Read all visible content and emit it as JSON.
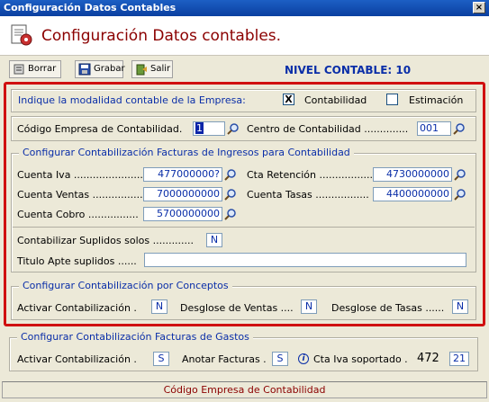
{
  "window": {
    "title": "Configuración Datos Contables",
    "close_glyph": "×"
  },
  "header": {
    "title": "Configuración Datos contables.",
    "icon": "document-settings-icon"
  },
  "toolbar": {
    "borrar_label": "Borrar",
    "grabar_label": "Grabar",
    "salir_label": "Salir",
    "nivel_label": "NIVEL CONTABLE: 10"
  },
  "modalidad": {
    "label": "Indique la modalidad contable de la Empresa:",
    "contabilidad_label": "Contabilidad",
    "contabilidad_checked": true,
    "contabilidad_mark": "X",
    "estimacion_label": "Estimación",
    "estimacion_checked": false
  },
  "empresa": {
    "codigo_label": "Código Empresa de Contabilidad.",
    "codigo_value": "1",
    "centro_label": "Centro de Contabilidad ..............",
    "centro_value": "001"
  },
  "ingresos": {
    "legend": "Configurar Contabilización Facturas de Ingresos para Contabilidad",
    "cuenta_iva_label": "Cuenta Iva .......................",
    "cuenta_iva_value": "477000000?",
    "cta_retencion_label": "Cta Retención .................",
    "cta_retencion_value": "4730000000",
    "cuenta_ventas_label": "Cuenta Ventas ................",
    "cuenta_ventas_value": "7000000000",
    "cuenta_tasas_label": "Cuenta Tasas .................",
    "cuenta_tasas_value": "4400000000",
    "cuenta_cobro_label": "Cuenta Cobro ................",
    "cuenta_cobro_value": "5700000000",
    "suplidos_label": "Contabilizar Suplidos solos .............",
    "suplidos_value": "N",
    "titulo_label": "Titulo Apte suplidos ......",
    "titulo_value": ""
  },
  "conceptos": {
    "legend": "Configurar Contabilización por Conceptos",
    "activar_label": "Activar Contabilización .",
    "activar_value": "N",
    "desglose_ventas_label": "Desglose de Ventas ....",
    "desglose_ventas_value": "N",
    "desglose_tasas_label": "Desglose de Tasas ......",
    "desglose_tasas_value": "N"
  },
  "gastos": {
    "legend": "Configurar Contabilización Facturas de Gastos",
    "activar_label": "Activar Contabilización .",
    "activar_value": "S",
    "anotar_label": "Anotar Facturas .",
    "anotar_value": "S",
    "info_glyph": "i",
    "cta_iva_label": "Cta Iva soportado .",
    "cta_iva_prefix": "472",
    "cta_iva_value": "21"
  },
  "status": {
    "text": "Código Empresa de Contabilidad"
  },
  "colors": {
    "accent_blue": "#0a2ea8",
    "title_red": "#8b0000",
    "highlight_frame": "#d01010"
  }
}
